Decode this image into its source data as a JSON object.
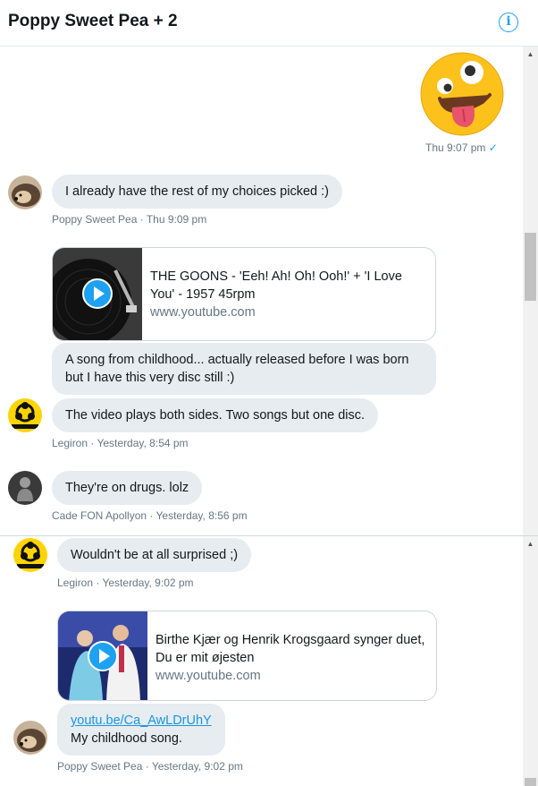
{
  "header": {
    "title": "Poppy Sweet Pea + 2",
    "info_icon": "info-icon"
  },
  "pane1": {
    "emoji": {
      "icon": "zany-face-emoji",
      "meta": "Thu 9:07 pm",
      "read_icon": "checkmark-icon"
    },
    "msg1": {
      "text": "I already have the rest of my choices picked :)",
      "meta": "Poppy Sweet Pea · Thu 9:09 pm"
    },
    "card1": {
      "title": "THE GOONS - 'Eeh! Ah! Oh! Ooh!' + 'I Love You' - 1957 45rpm",
      "domain": "www.youtube.com",
      "icon": "play-icon"
    },
    "msg2": {
      "text": "A song from childhood... actually released before I was born but I have this very disc still :)"
    },
    "msg3": {
      "text": "The video plays both sides. Two songs but one disc.",
      "meta": "Legiron · Yesterday, 8:54 pm"
    },
    "msg4": {
      "text": "They're on drugs. lolz",
      "meta": "Cade FON Apollyon · Yesterday, 8:56 pm"
    }
  },
  "pane2": {
    "msg1": {
      "text": "Wouldn't be at all surprised ;)",
      "meta": "Legiron · Yesterday, 9:02 pm"
    },
    "card2": {
      "title": "Birthe Kjær og Henrik Krogsgaard synger duet, Du er mit øjesten",
      "domain": "www.youtube.com",
      "icon": "play-icon"
    },
    "msg2": {
      "link": "youtu.be/Ca_AwLDrUhY",
      "text": "My childhood song.",
      "meta": "Poppy Sweet Pea · Yesterday, 9:02 pm"
    }
  },
  "colors": {
    "accent": "#1da1f2",
    "bubble": "#e6ecf0",
    "meta": "#657786",
    "link": "#1b95e0"
  },
  "avatar_badge": "biohazard"
}
